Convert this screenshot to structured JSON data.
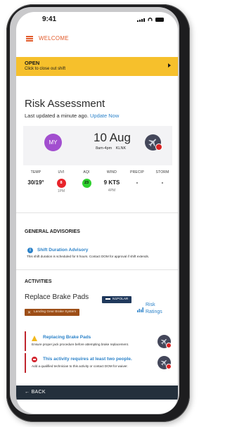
{
  "status_bar": {
    "time": "9:41"
  },
  "header": {
    "title": "WELCOME"
  },
  "banner": {
    "title": "OPEN",
    "subtitle": "Click to close out shift"
  },
  "page": {
    "title": "Risk Assessment",
    "updated_text": "Last updated a minute ago.",
    "update_link": "Update Now"
  },
  "date_card": {
    "avatar_initials": "MY",
    "date": "10 Aug",
    "time_range": "8am-4pm",
    "station": "KLNK",
    "avatar_color": "#a24ecf"
  },
  "weather": [
    {
      "label": "TEMP",
      "value": "30/19°",
      "sub": ""
    },
    {
      "label": "UVI",
      "value": "8",
      "sub": "1PM",
      "pill_color": "#e8242b"
    },
    {
      "label": "AQI",
      "value": "23",
      "sub": "",
      "pill_color": "#2ed12e"
    },
    {
      "label": "WIND",
      "value": "9 KTS",
      "sub": "4PM"
    },
    {
      "label": "PRECIP",
      "value": "-",
      "sub": ""
    },
    {
      "label": "STORM",
      "value": "-",
      "sub": ""
    }
  ],
  "advisories": {
    "section_title": "GENERAL ADVISORIES",
    "items": [
      {
        "icon": "info-icon",
        "title": "Shift Duration Advisory",
        "body": "This shift duration is scheduled for 8 hours. Contact DOM for approval if shift extends."
      }
    ]
  },
  "activities": {
    "section_title": "ACTIVITIES",
    "name": "Replace Brake Pads",
    "aircraft_tag": "N1POLAR",
    "system_tag": "Landing Gear Brake System",
    "risk_label": "Risk Ratings",
    "alerts": [
      {
        "icon": "warning-icon",
        "title": "Replacing Brake Pads",
        "body": "Ensure proper jack procedure before attempting brake replacement."
      },
      {
        "icon": "stop-icon",
        "title": "This activity requires at least two people.",
        "body": "Add a qualified technician to this activity or contact DOM for waiver."
      }
    ]
  },
  "footer": {
    "back_label": "BACK"
  },
  "colors": {
    "accent": "#e25b2b",
    "banner": "#f6c02c",
    "link": "#2b82c9",
    "footer": "#24303c",
    "danger": "#d3242d"
  }
}
